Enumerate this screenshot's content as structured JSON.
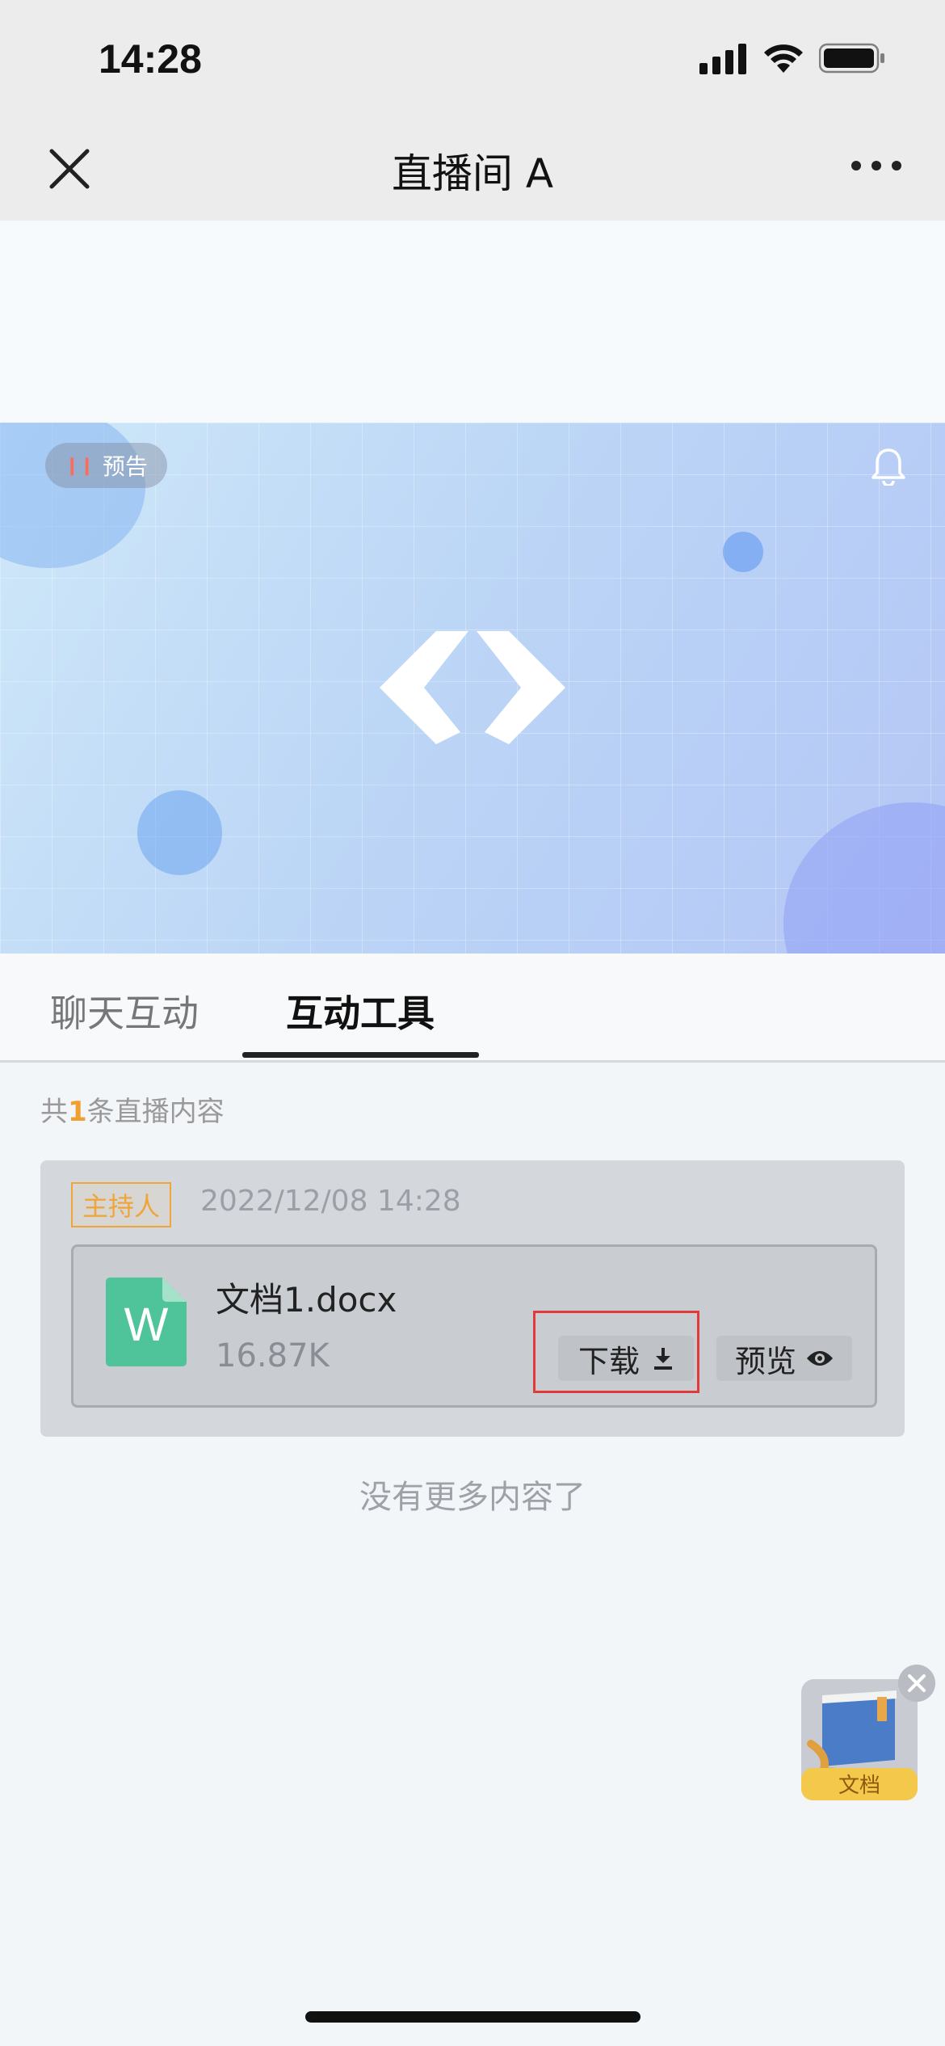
{
  "status_bar": {
    "time": "14:28"
  },
  "nav": {
    "title": "直播间 A"
  },
  "video": {
    "badge_label": "预告",
    "colors": {
      "background": "#bcd6f6"
    }
  },
  "tabs": [
    {
      "label": "聊天互动",
      "active": false
    },
    {
      "label": "互动工具",
      "active": true
    }
  ],
  "summary": {
    "prefix": "共",
    "count": "1",
    "suffix": "条直播内容"
  },
  "card": {
    "host_tag": "主持人",
    "time": "2022/12/08 14:28",
    "file": {
      "icon_letter": "W",
      "name": "文档1.docx",
      "size": "16.87K",
      "download_label": "下载",
      "preview_label": "预览"
    }
  },
  "footer_text": "没有更多内容了",
  "float_widget": {
    "label": "文档"
  },
  "colors": {
    "accent": "#f0a53a",
    "highlight": "#e03a3a",
    "doc_green": "#4fc39a"
  }
}
